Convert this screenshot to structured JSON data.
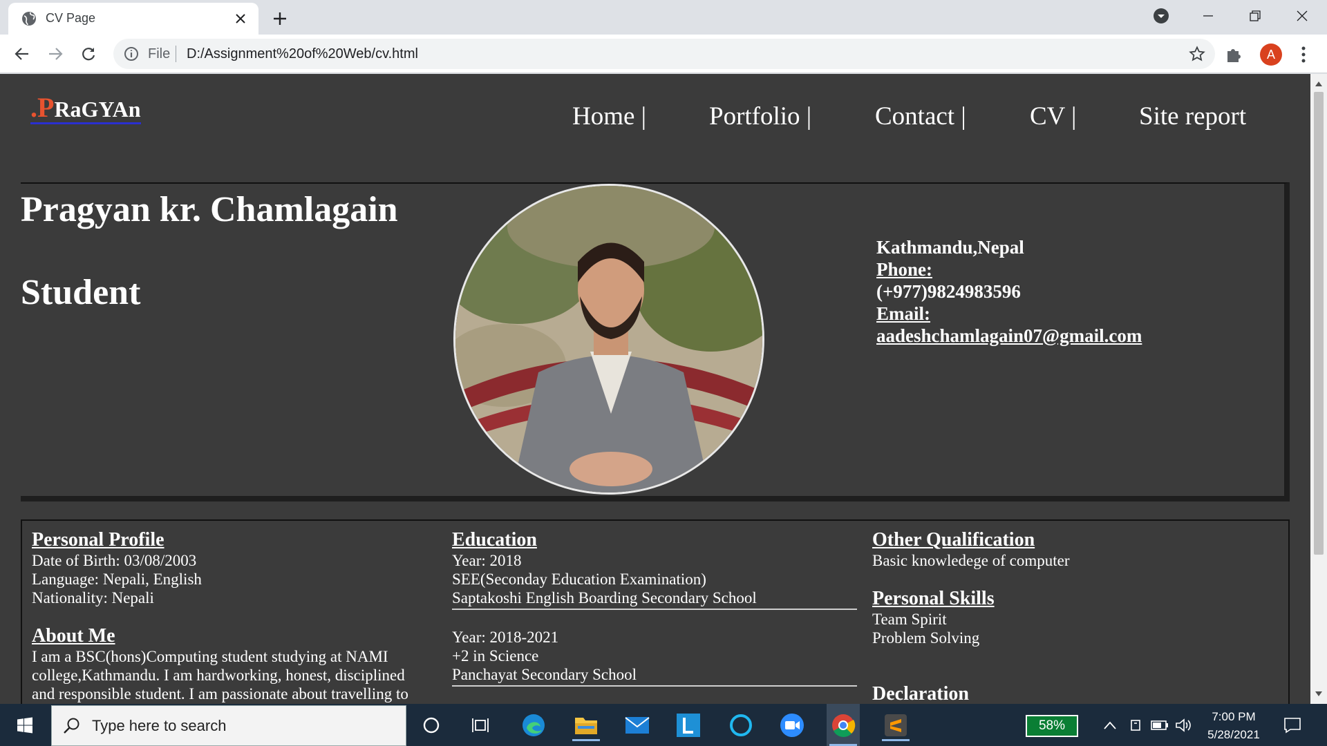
{
  "browser": {
    "tab_title": "CV Page",
    "omnibox_scheme": "File",
    "url": "D:/Assignment%20of%20Web/cv.html",
    "profile_initial": "A"
  },
  "site": {
    "logo_dot": ".",
    "logo_p": "P",
    "logo_rest": "RaGYAn",
    "nav": [
      {
        "label": "Home |"
      },
      {
        "label": "Portfolio |"
      },
      {
        "label": "Contact |"
      },
      {
        "label": "CV |"
      },
      {
        "label": "Site report"
      }
    ]
  },
  "hero": {
    "name": "Pragyan kr. Chamlagain",
    "role": "Student",
    "location": "Kathmandu,Nepal",
    "phone_label": "Phone:",
    "phone": "(+977)9824983596",
    "email_label": "Email:",
    "email": "aadeshchamlagain07@gmail.com"
  },
  "profile": {
    "title": "Personal Profile",
    "dob": "Date of Birth: 03/08/2003",
    "language": "Language: Nepali, English",
    "nationality": "Nationality: Nepali"
  },
  "about": {
    "title": "About Me",
    "line1": "I am a BSC(hons)Computing student studying at NAMI",
    "line2": "college,Kathmandu. I am hardworking, honest, disciplined",
    "line3": "and responsible student. I am passionate about travelling to"
  },
  "education": {
    "title": "Education",
    "entries": [
      {
        "year": "Year: 2018",
        "course": "SEE(Seconday Education Examination)",
        "school": "Saptakoshi English Boarding Secondary School"
      },
      {
        "year": "Year: 2018-2021",
        "course": "+2 in Science",
        "school": "Panchayat Secondary School"
      }
    ]
  },
  "other": {
    "title": "Other Qualification",
    "text": "Basic knowledege of computer"
  },
  "skills": {
    "title": "Personal Skills",
    "items": [
      "Team Spirit",
      "Problem Solving"
    ]
  },
  "declaration": {
    "title": "Declaration"
  },
  "taskbar": {
    "search_placeholder": "Type here to search",
    "battery": "58%",
    "time": "7:00 PM",
    "date": "5/28/2021"
  }
}
